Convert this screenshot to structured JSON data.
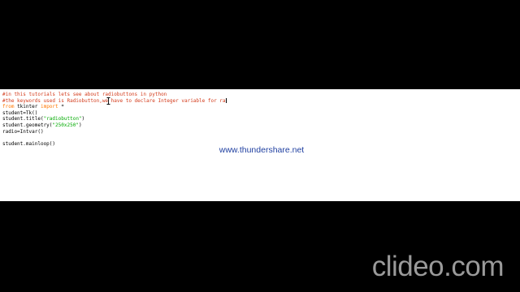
{
  "code_lines": [
    {
      "type": "comment",
      "text": "#in this tutorials lets see about radiobuttons in python"
    },
    {
      "type": "comment",
      "text": "#the keywords used is Radiobutton,we have to declare Integer variable for ra"
    },
    {
      "type": "import",
      "kw1": "from",
      "mod": " tkinter ",
      "kw2": "import",
      "rest": " *"
    },
    {
      "type": "plain",
      "text": "student=Tk()"
    },
    {
      "type": "call",
      "pre": "student.title(",
      "str": "\"radiobutton\"",
      "post": ")"
    },
    {
      "type": "call",
      "pre": "student.geometry(",
      "str": "\"250x250\"",
      "post": ")"
    },
    {
      "type": "plain",
      "text": "radio=Intvar()"
    },
    {
      "type": "plain",
      "text": ""
    },
    {
      "type": "plain",
      "text": "student.mainloop()"
    }
  ],
  "overlay": {
    "website": "www.thundershare.net",
    "logo": "clideo.com"
  },
  "colors": {
    "comment": "#d33a1a",
    "keyword": "#ff7700",
    "string": "#00aa00",
    "website": "#1f3fa0",
    "logo": "#9a9a9a"
  },
  "icons": {
    "text_cursor": "i-beam-cursor-icon"
  }
}
